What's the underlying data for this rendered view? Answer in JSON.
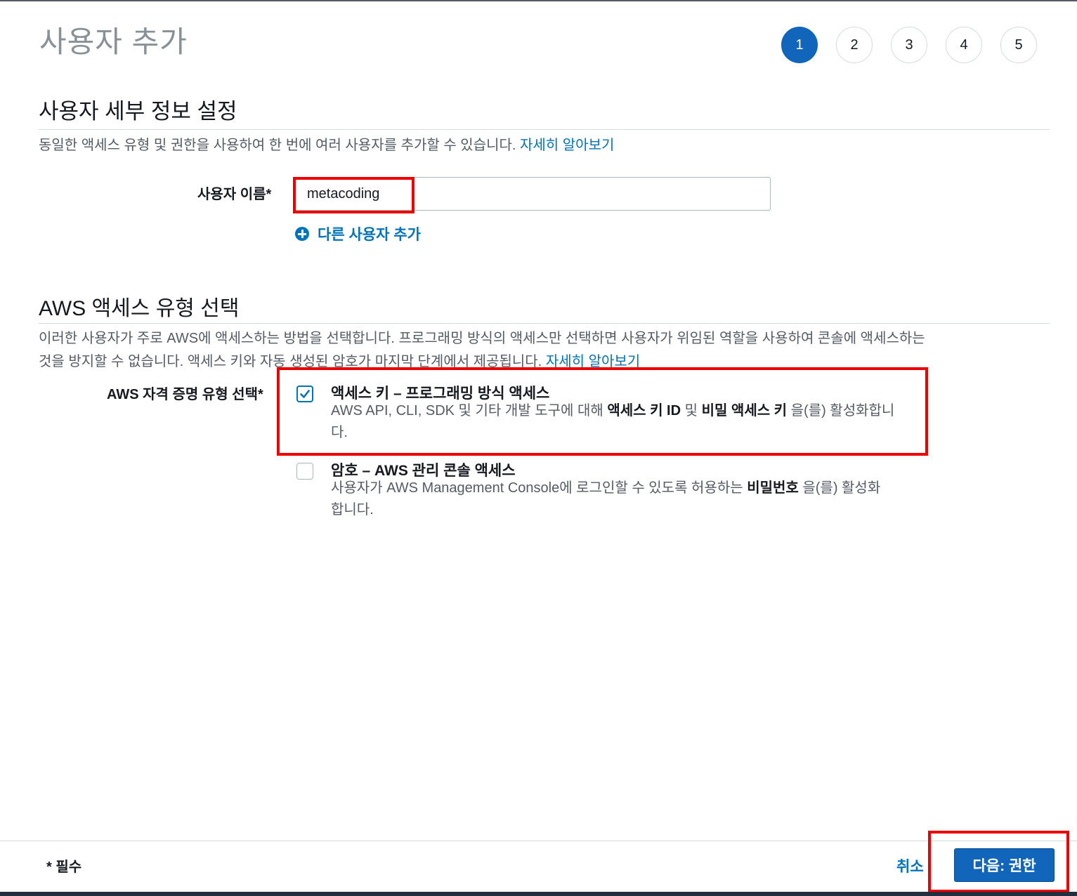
{
  "page": {
    "title": "사용자 추가"
  },
  "steps": [
    "1",
    "2",
    "3",
    "4",
    "5"
  ],
  "active_step": 1,
  "details": {
    "title": "사용자 세부 정보 설정",
    "description": "동일한 액세스 유형 및 권한을 사용하여 한 번에 여러 사용자를 추가할 수 있습니다.",
    "learn_more": "자세히 알아보기",
    "username_label": "사용자 이름*",
    "username_value": "metacoding",
    "add_user_label": "다른 사용자 추가"
  },
  "access": {
    "title": "AWS 액세스 유형 선택",
    "description_line1": "이러한 사용자가 주로 AWS에 액세스하는 방법을 선택합니다. 프로그래밍 방식의 액세스만 선택하면 사용자가 위임된 역할을 사용하여 콘솔에 액세스하는",
    "description_line2": "것을 방지할 수 없습니다. 액세스 키와 자동 생성된 암호가 마지막 단계에서 제공됩니다.",
    "learn_more": "자세히 알아보기",
    "credential_label": "AWS 자격 증명 유형 선택*",
    "options": [
      {
        "title": "액세스 키 – 프로그래밍 방식 액세스",
        "checked": true,
        "desc_a": "AWS API, CLI, SDK 및 기타 개발 도구에 대해 ",
        "desc_b1": "액세스 키 ID",
        "desc_c": " 및 ",
        "desc_b2": "비밀 액세스 키",
        "desc_d": " 을(를) 활성화합니다."
      },
      {
        "title": "암호 – AWS 관리 콘솔 액세스",
        "checked": false,
        "desc_a": "사용자가 AWS Management Console에 로그인할 수 있도록 허용하는 ",
        "desc_b1": "비밀번호",
        "desc_d": " 을(를) 활성화합니다."
      }
    ]
  },
  "footer": {
    "required_note": "* 필수",
    "cancel_label": "취소",
    "next_label": "다음: 권한"
  },
  "colors": {
    "primary": "#1166bb",
    "link": "#0073bb",
    "highlight": "#ee0000"
  }
}
